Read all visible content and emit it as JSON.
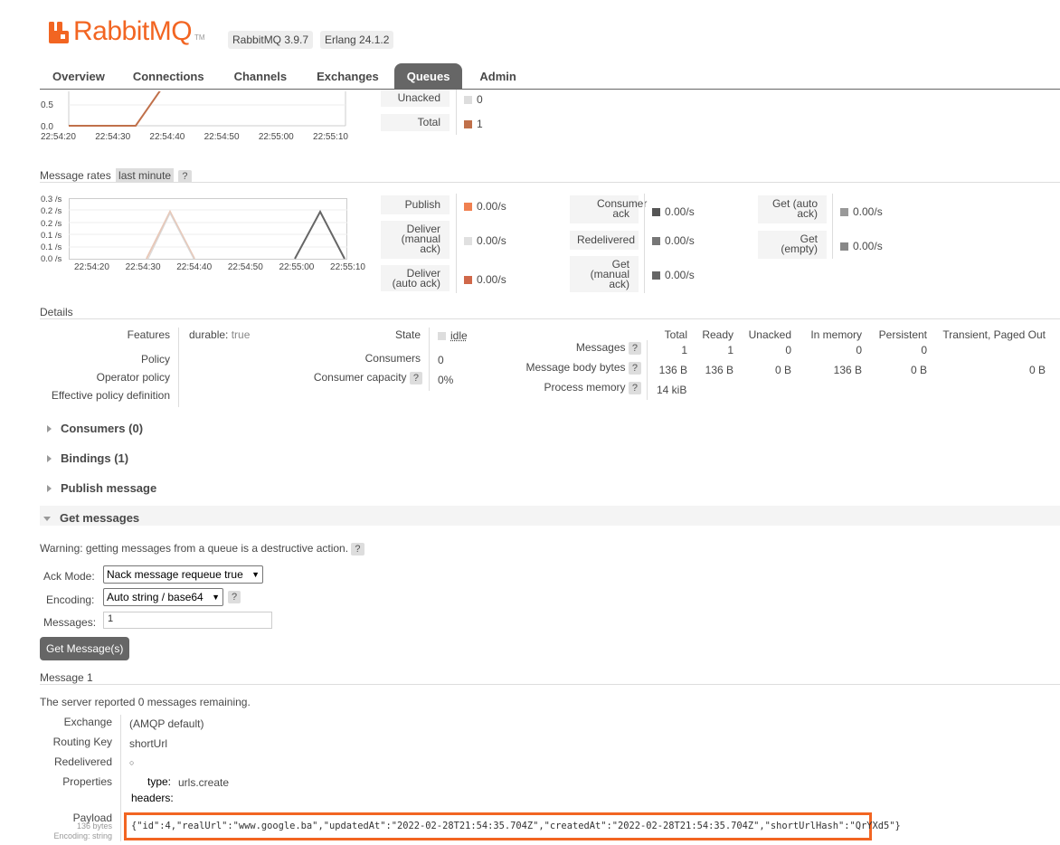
{
  "header": {
    "logo_text": "RabbitMQ",
    "logo_tm": "TM",
    "version": "RabbitMQ 3.9.7",
    "erlang": "Erlang 24.1.2",
    "brand_color": "#f26522"
  },
  "tabs": [
    {
      "label": "Overview"
    },
    {
      "label": "Connections"
    },
    {
      "label": "Channels"
    },
    {
      "label": "Exchanges"
    },
    {
      "label": "Queues",
      "active": true
    },
    {
      "label": "Admin"
    }
  ],
  "queued_chart": {
    "y_ticks": [
      "0.5",
      "0.0"
    ],
    "x_ticks": [
      "22:54:20",
      "22:54:30",
      "22:54:40",
      "22:54:50",
      "22:55:00",
      "22:55:10"
    ],
    "legend": [
      {
        "label": "Unacked",
        "value": "0",
        "color": "#dddddd"
      },
      {
        "label": "Total",
        "value": "1",
        "color": "#c0704a"
      }
    ]
  },
  "rates": {
    "title": "Message rates",
    "range": "last minute",
    "help": "?",
    "y_ticks": [
      "0.3 /s",
      "0.2 /s",
      "0.2 /s",
      "0.1 /s",
      "0.1 /s",
      "0.0 /s"
    ],
    "x_ticks": [
      "22:54:20",
      "22:54:30",
      "22:54:40",
      "22:54:50",
      "22:55:00",
      "22:55:10"
    ],
    "col1": [
      {
        "label": "Publish",
        "value": "0.00/s",
        "color": "#f08050"
      },
      {
        "label": "Deliver (manual ack)",
        "value": "0.00/s",
        "color": "#e0e0e0"
      },
      {
        "label": "Deliver (auto ack)",
        "value": "0.00/s",
        "color": "#d0684a"
      }
    ],
    "col2": [
      {
        "label": "Consumer ack",
        "value": "0.00/s",
        "color": "#555555"
      },
      {
        "label": "Redelivered",
        "value": "0.00/s",
        "color": "#777777"
      },
      {
        "label": "Get (manual ack)",
        "value": "0.00/s",
        "color": "#666666"
      }
    ],
    "col3": [
      {
        "label": "Get (auto ack)",
        "value": "0.00/s",
        "color": "#999999"
      },
      {
        "label": "Get (empty)",
        "value": "0.00/s",
        "color": "#888888"
      }
    ]
  },
  "details": {
    "title": "Details",
    "features_label": "Features",
    "features_key": "durable:",
    "features_value": "true",
    "policy_label": "Policy",
    "operator_policy_label": "Operator policy",
    "effective_policy_label": "Effective policy definition",
    "state_label": "State",
    "state_value": "idle",
    "consumers_label": "Consumers",
    "consumers_value": "0",
    "consumer_capacity_label": "Consumer capacity",
    "consumer_capacity_value": "0%",
    "help": "?",
    "msg_headers": [
      "Total",
      "Ready",
      "Unacked",
      "In memory",
      "Persistent",
      "Transient, Paged Out"
    ],
    "rows": [
      {
        "label": "Messages",
        "values": [
          "1",
          "1",
          "0",
          "0",
          "0",
          ""
        ]
      },
      {
        "label": "Message body bytes",
        "values": [
          "136 B",
          "136 B",
          "0 B",
          "136 B",
          "0 B",
          "0 B"
        ]
      },
      {
        "label": "Process memory",
        "values": [
          "14 kiB"
        ]
      }
    ]
  },
  "sections": {
    "consumers": "Consumers (0)",
    "bindings": "Bindings (1)",
    "publish": "Publish message",
    "get": "Get messages"
  },
  "get_messages": {
    "warning": "Warning: getting messages from a queue is a destructive action.",
    "help": "?",
    "ack_mode_label": "Ack Mode:",
    "ack_mode_value": "Nack message requeue true",
    "encoding_label": "Encoding:",
    "encoding_value": "Auto string / base64",
    "messages_label": "Messages:",
    "messages_value": "1",
    "button": "Get Message(s)"
  },
  "message": {
    "title": "Message 1",
    "remaining_prefix": "The server reported ",
    "remaining_count": "0",
    "remaining_suffix": " messages remaining.",
    "exchange_label": "Exchange",
    "exchange_value": "(AMQP default)",
    "routing_key_label": "Routing Key",
    "routing_key_value": "shortUrl",
    "redelivered_label": "Redelivered",
    "redelivered_value": "○",
    "properties_label": "Properties",
    "type_label": "type:",
    "type_value": "urls.create",
    "headers_label": "headers:",
    "payload_label": "Payload",
    "payload_bytes": "136 bytes",
    "payload_encoding": "Encoding: string",
    "payload": "{\"id\":4,\"realUrl\":\"www.google.ba\",\"updatedAt\":\"2022-02-28T21:54:35.704Z\",\"createdAt\":\"2022-02-28T21:54:35.704Z\",\"shortUrlHash\":\"QrYXd5\"}"
  }
}
